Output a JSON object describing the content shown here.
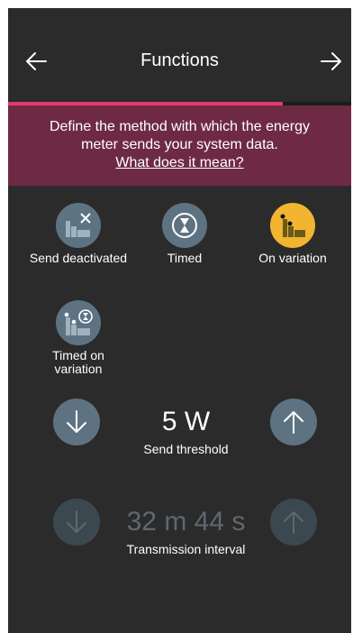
{
  "header": {
    "title": "Functions"
  },
  "progress": {
    "fraction": 0.8,
    "color": "#e03a6d"
  },
  "banner": {
    "description": "Define the method with which the energy meter sends your system data.",
    "link": "What does it mean?",
    "color": "#6e2a44"
  },
  "options": [
    {
      "label": "Send deactivated",
      "icon": "send-deactivated-icon",
      "selected": false
    },
    {
      "label": "Timed",
      "icon": "hourglass-icon",
      "selected": false
    },
    {
      "label": "On variation",
      "icon": "variation-chart-icon",
      "selected": true
    },
    {
      "label": "Timed on variation",
      "icon": "timed-variation-icon",
      "selected": false
    }
  ],
  "threshold": {
    "value": "5 W",
    "label": "Send threshold"
  },
  "interval": {
    "value": "32 m 44 s",
    "label": "Transmission interval",
    "enabled": false
  },
  "colors": {
    "accent": "#f2b530",
    "button": "#5e7381",
    "background": "#2b2b2b"
  }
}
